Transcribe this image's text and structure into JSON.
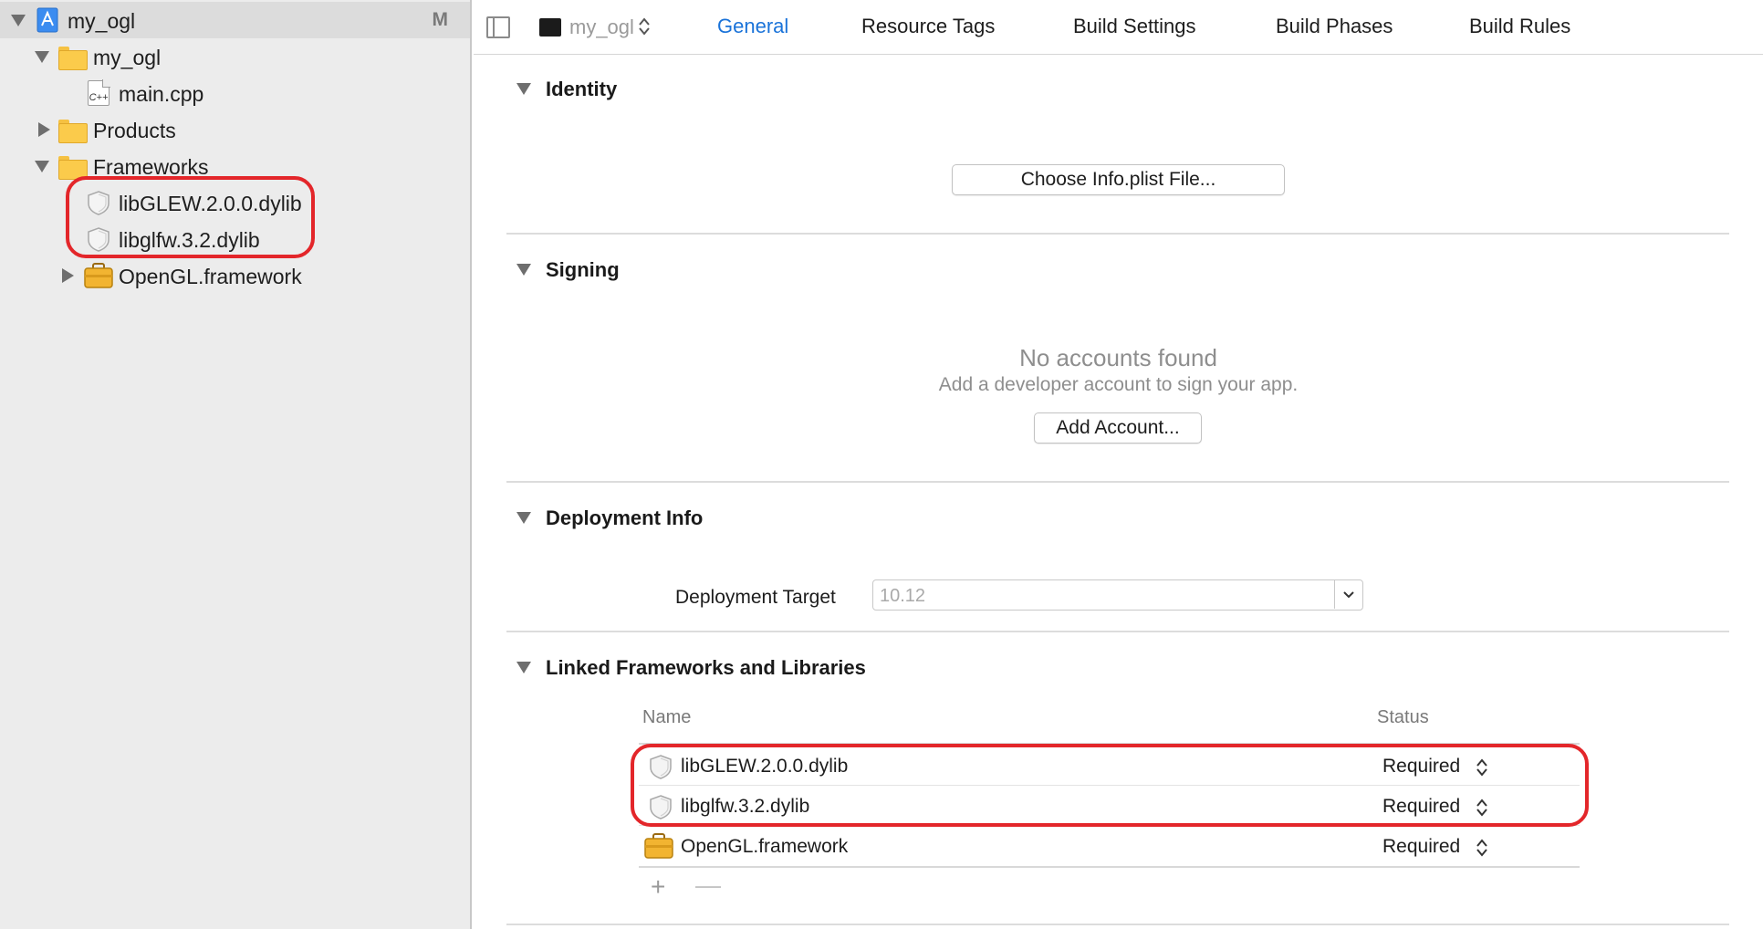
{
  "sidebar": {
    "project": {
      "label": "my_ogl",
      "badge": "M"
    },
    "group": {
      "label": "my_ogl"
    },
    "main_file": {
      "label": "main.cpp",
      "icon_text": "C++"
    },
    "products": {
      "label": "Products"
    },
    "frameworks": {
      "label": "Frameworks"
    },
    "libs": [
      {
        "label": "libGLEW.2.0.0.dylib"
      },
      {
        "label": "libglfw.3.2.dylib"
      }
    ],
    "opengl": {
      "label": "OpenGL.framework"
    }
  },
  "tabbar": {
    "target": "my_ogl",
    "tabs": [
      "General",
      "Resource Tags",
      "Build Settings",
      "Build Phases",
      "Build Rules"
    ],
    "active_tab": "General"
  },
  "identity": {
    "header": "Identity",
    "choose_button": "Choose Info.plist File..."
  },
  "signing": {
    "header": "Signing",
    "empty_title": "No accounts found",
    "empty_subtitle": "Add a developer account to sign your app.",
    "add_button": "Add Account..."
  },
  "deployment": {
    "header": "Deployment Info",
    "target_label": "Deployment Target",
    "target_value": "10.12"
  },
  "linked": {
    "header": "Linked Frameworks and Libraries",
    "columns": {
      "name": "Name",
      "status": "Status"
    },
    "rows": [
      {
        "name": "libGLEW.2.0.0.dylib",
        "status": "Required",
        "kind": "library"
      },
      {
        "name": "libglfw.3.2.dylib",
        "status": "Required",
        "kind": "library"
      },
      {
        "name": "OpenGL.framework",
        "status": "Required",
        "kind": "framework"
      }
    ],
    "add_symbol": "+",
    "remove_symbol": "—"
  },
  "colors": {
    "accent": "#1a73d9",
    "highlight": "#e3262a",
    "sidebar_bg": "#ececec"
  }
}
